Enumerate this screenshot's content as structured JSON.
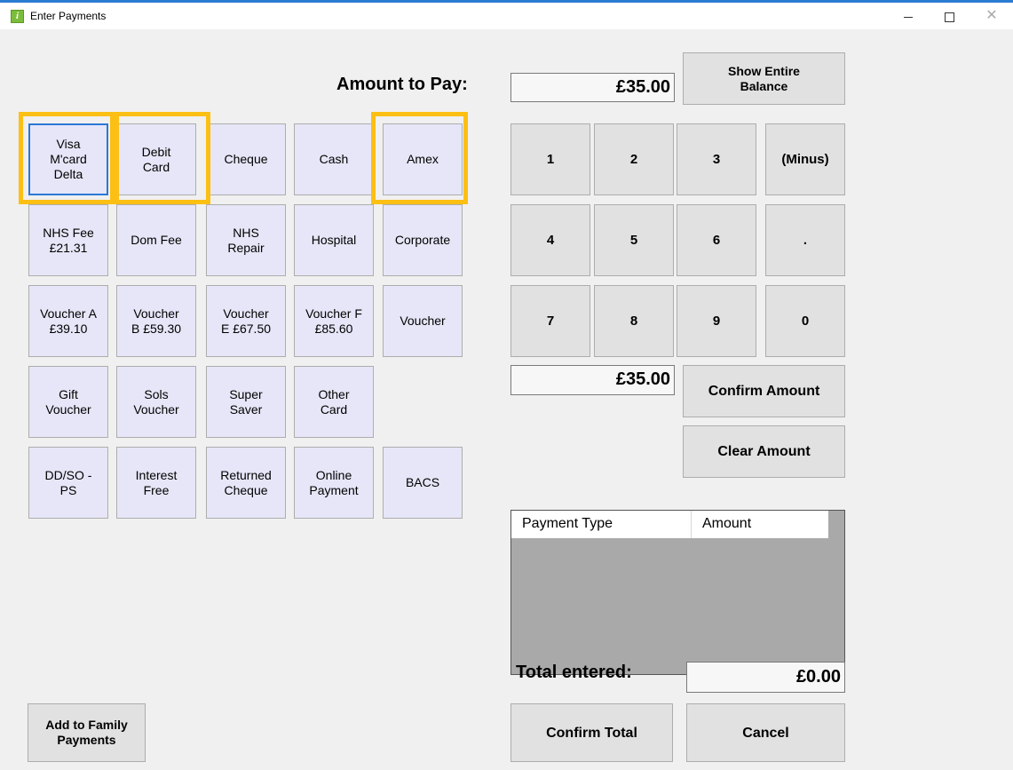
{
  "window": {
    "title": "Enter Payments",
    "icon": "info-icon",
    "icon_glyph": "i",
    "minimize_glyph": "",
    "close_glyph": "✕"
  },
  "amount_to_pay": {
    "label": "Amount to Pay:",
    "value": "£35.00"
  },
  "show_entire_balance_label": "Show Entire\nBalance",
  "payment_buttons": [
    [
      "Visa\nM'card\nDelta",
      "Debit\nCard",
      "Cheque",
      "Cash",
      "Amex"
    ],
    [
      "NHS Fee\n£21.31",
      "Dom Fee",
      "NHS\nRepair",
      "Hospital",
      "Corporate"
    ],
    [
      "Voucher A\n£39.10",
      "Voucher\nB  £59.30",
      "Voucher\nE  £67.50",
      "Voucher F\n£85.60",
      "Voucher"
    ],
    [
      "Gift\nVoucher",
      "Sols\nVoucher",
      "Super\nSaver",
      "Other\nCard"
    ],
    [
      "DD/SO -\nPS",
      "Interest\nFree",
      "Returned\nCheque",
      "Online\nPayment",
      "BACS"
    ]
  ],
  "keypad": [
    [
      "1",
      "2",
      "3",
      "(Minus)"
    ],
    [
      "4",
      "5",
      "6",
      "."
    ],
    [
      "7",
      "8",
      "9",
      "0"
    ]
  ],
  "entered_amount": "£35.00",
  "confirm_amount_label": "Confirm Amount",
  "clear_amount_label": "Clear Amount",
  "grid": {
    "columns": [
      "Payment Type",
      "Amount"
    ]
  },
  "total_entered": {
    "label": "Total entered:",
    "value": "£0.00"
  },
  "add_to_family_label": "Add to Family\nPayments",
  "confirm_total_label": "Confirm Total",
  "cancel_label": "Cancel",
  "colors": {
    "highlight": "#fcbf13",
    "payment_button": "#e6e6f8",
    "focus": "#2b78d4"
  }
}
